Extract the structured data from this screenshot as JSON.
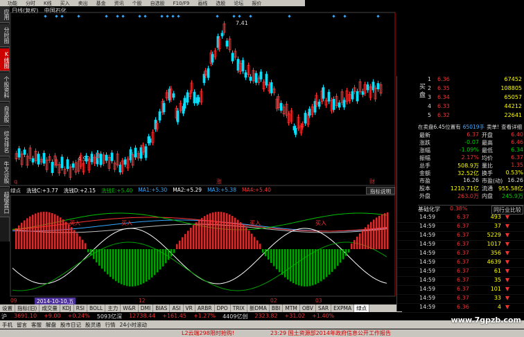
{
  "topbar": [
    "功能",
    "分时",
    "K线",
    "买入",
    "卖出",
    "基金",
    "资讯",
    "个股",
    "自选股",
    "F10/F9",
    "画线",
    "选股",
    "论坛",
    "报价"
  ],
  "lefttabs": [
    "应用",
    "分时图",
    "K线图",
    "个股资料",
    "自选股",
    "综合排名",
    "牛叉诊股",
    "超级盘口"
  ],
  "lefttabs_active": 2,
  "chart": {
    "title": "日线(复权)",
    "stock_name": "中国石化",
    "price_labels": [
      "7.41",
      "6.47",
      "5.93",
      "5.39",
      "4.99"
    ],
    "markers": [
      "q",
      "涨",
      "财"
    ]
  },
  "indicator": {
    "name": "绿点",
    "items": [
      {
        "label": "洗钱C:",
        "value": "+3.77",
        "color": "#ffffff"
      },
      {
        "label": "洗钱D:",
        "value": "+2.15",
        "color": "#ffffff"
      },
      {
        "label": "洗钱E:",
        "value": "+5.40",
        "color": "#00c000"
      },
      {
        "label": "MA1:",
        "value": "+5.30",
        "color": "#33aaff"
      },
      {
        "label": "MA2:",
        "value": "+5.29",
        "color": "#ffffff"
      },
      {
        "label": "MA3:",
        "value": "+5.38",
        "color": "#33aaff"
      },
      {
        "label": "MA4:",
        "value": "+5.40",
        "color": "#ff3333"
      }
    ],
    "help": "指标说明",
    "axis": [
      "7.83",
      "6.30",
      "4.78",
      "3.22",
      "1.70"
    ],
    "buy_labels": [
      "买入",
      "买入",
      "买入",
      "买入",
      "买入"
    ]
  },
  "datebar": {
    "labels": [
      "09",
      "12",
      "02",
      "03"
    ],
    "selected": "2014-10-10,五"
  },
  "indicator_tabs": [
    "设置",
    "指标(旧)",
    "成交量",
    "KDJ",
    "RSI",
    "BOLL",
    "主力",
    "W&R",
    "DMI",
    "BIAS",
    "ASI",
    "VR",
    "ARBR",
    "DPO",
    "TRIX",
    "新DMA",
    "BBI",
    "MTM",
    "OBV",
    "SAR",
    "EXPMA",
    "绿点"
  ],
  "active_tab": "绿点",
  "ticker": [
    {
      "text": "沪",
      "color": "#ddd"
    },
    {
      "text": "3691.10",
      "color": "#e33"
    },
    {
      "text": "+9.00",
      "color": "#e33"
    },
    {
      "text": "+0.24%",
      "color": "#e33"
    },
    {
      "text": "5093亿深",
      "color": "#ddd"
    },
    {
      "text": "12738.44",
      "color": "#e33"
    },
    {
      "text": "+161.45",
      "color": "#e33"
    },
    {
      "text": "+1.27%",
      "color": "#e33"
    },
    {
      "text": "4409亿创",
      "color": "#ddd"
    },
    {
      "text": "2323.82",
      "color": "#e33"
    },
    {
      "text": "+31.02",
      "color": "#e33"
    },
    {
      "text": "+1.40%",
      "color": "#e33"
    }
  ],
  "bottombar": [
    "手机",
    "留言",
    "客服",
    "解盘",
    "股市日记",
    "股灵通",
    "行情",
    "24小时滚动"
  ],
  "marquee": [
    {
      "text": "L2云端298限时抢购!",
      "color": "#c00"
    },
    {
      "text": "23:29 国土资源部2014年政府信息公开工作报告",
      "color": "#c00"
    }
  ],
  "right_panel": {
    "side_buy": "买盘",
    "side_sell": "卖盘",
    "buy_book": [
      {
        "n": "1",
        "p": "6.36",
        "v": "67452"
      },
      {
        "n": "2",
        "p": "6.35",
        "v": "108805"
      },
      {
        "n": "3",
        "p": "6.34",
        "v": "65057"
      },
      {
        "n": "4",
        "p": "6.33",
        "v": "44212"
      },
      {
        "n": "5",
        "p": "6.32",
        "v": "22641"
      }
    ],
    "status": [
      {
        "text": "在卖盘6.45位置有",
        "color": "#ddd"
      },
      {
        "text": "65019手",
        "color": "#44aaff"
      },
      {
        "text": "卖单!",
        "color": "#ddd"
      },
      {
        "text": "查看详细",
        "color": "#ddd"
      }
    ],
    "stats": [
      {
        "k1": "最新",
        "v1": "6.37",
        "c1": "#e33",
        "k2": "开盘",
        "v2": "6.40",
        "c2": "#e33"
      },
      {
        "k1": "涨跌",
        "v1": "-0.07",
        "c1": "#0c0",
        "k2": "最高",
        "v2": "6.46",
        "c2": "#e33"
      },
      {
        "k1": "涨幅",
        "v1": "-1.09%",
        "c1": "#0c0",
        "k2": "最低",
        "v2": "6.34",
        "c2": "#0c0"
      },
      {
        "k1": "振幅",
        "v1": "2.17%",
        "c1": "#e33",
        "k2": "均价",
        "v2": "6.37",
        "c2": "#e33"
      },
      {
        "k1": "总手",
        "v1": "508.9万",
        "c1": "#ff0",
        "k2": "量比",
        "v2": "1.35",
        "c2": "#e33"
      },
      {
        "k1": "金额",
        "v1": "32.52亿",
        "c1": "#ff0",
        "k2": "换手",
        "v2": "0.53%",
        "c2": "#ff0"
      },
      {
        "k1": "市盈",
        "v1": "16.26",
        "c1": "#ddd",
        "k2": "市盈(动)",
        "v2": "16.26",
        "c2": "#ddd"
      },
      {
        "k1": "股本",
        "v1": "1210.71亿",
        "c1": "#ff0",
        "k2": "流通",
        "v2": "955.58亿",
        "c2": "#ff0"
      },
      {
        "k1": "外盘",
        "v1": "263.0万",
        "c1": "#e33",
        "k2": "内盘",
        "v2": "245.9万",
        "c2": "#0c0"
      }
    ],
    "sector": {
      "name": "基础化学",
      "change": "0.38%",
      "link": "同行业比较"
    },
    "trades": [
      {
        "t": "14:59",
        "p": "6.37",
        "v": "493",
        "dir": "down"
      },
      {
        "t": "14:59",
        "p": "6.37",
        "v": "37",
        "dir": "down"
      },
      {
        "t": "14:59",
        "p": "6.37",
        "v": "5229",
        "dir": "down"
      },
      {
        "t": "14:59",
        "p": "6.37",
        "v": "1017",
        "dir": "down"
      },
      {
        "t": "14:59",
        "p": "6.37",
        "v": "356",
        "dir": "down"
      },
      {
        "t": "14:59",
        "p": "6.37",
        "v": "4639",
        "dir": "down"
      },
      {
        "t": "14:59",
        "p": "6.37",
        "v": "61",
        "dir": "down"
      },
      {
        "t": "14:59",
        "p": "6.37",
        "v": "35",
        "dir": "down"
      },
      {
        "t": "14:59",
        "p": "6.37",
        "v": "101",
        "dir": "down"
      },
      {
        "t": "14:59",
        "p": "6.37",
        "v": "33",
        "dir": "down"
      },
      {
        "t": "14:59",
        "p": "6.36",
        "v": "4",
        "dir": "down"
      }
    ]
  },
  "watermark": "www.7gpzb.com",
  "colors": {
    "up": "#ff3333",
    "down": "#00e0ff",
    "accent": "#c00000"
  }
}
